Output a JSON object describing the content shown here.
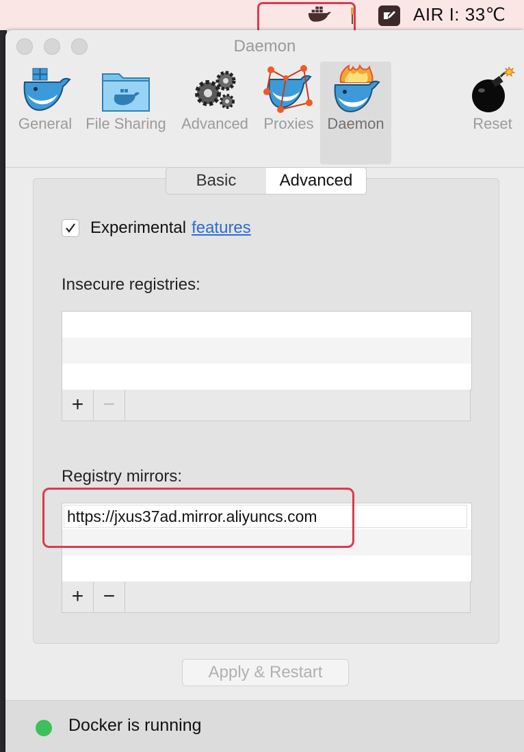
{
  "menubar": {
    "docker_icon": "docker-whale-icon",
    "pin_icon": "pin-icon",
    "note_icon": "note-edit-icon",
    "temperature": "AIR I: 33℃"
  },
  "window": {
    "title": "Daemon"
  },
  "toolbar": {
    "items": [
      {
        "label": "General",
        "icon": "docker-whale-icon"
      },
      {
        "label": "File Sharing",
        "icon": "folder-whale-icon"
      },
      {
        "label": "Advanced",
        "icon": "gears-icon"
      },
      {
        "label": "Proxies",
        "icon": "proxy-whale-icon"
      },
      {
        "label": "Daemon",
        "icon": "flaming-whale-icon",
        "selected": true
      },
      {
        "label": "Reset",
        "icon": "bomb-icon"
      }
    ]
  },
  "tabs": {
    "basic": "Basic",
    "advanced": "Advanced",
    "active": "Advanced"
  },
  "experimental": {
    "checked": true,
    "label": "Experimental",
    "link": "features"
  },
  "insecure_registries": {
    "label": "Insecure registries:",
    "add": "+",
    "remove": "−"
  },
  "registry_mirrors": {
    "label": "Registry mirrors:",
    "items": [
      "https://jxus37ad.mirror.aliyuncs.com"
    ],
    "add": "+",
    "remove": "−"
  },
  "apply_button": "Apply & Restart",
  "status": {
    "text": "Docker is running",
    "color": "#3cc15a"
  },
  "colors": {
    "annotation": "#e0384e",
    "link": "#2a6bd6"
  }
}
